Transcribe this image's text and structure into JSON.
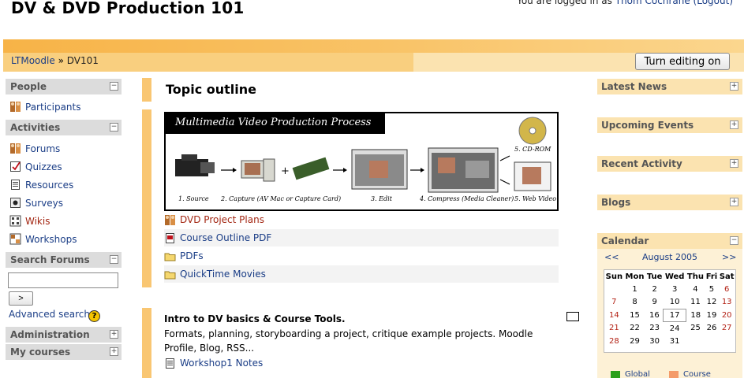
{
  "header": {
    "site_title": "DV & DVD Production 101",
    "login_prefix": "You are logged in as",
    "user_name": "Thom Cochrane",
    "logout_label": "(Logout)"
  },
  "nav": {
    "breadcrumb_home": "LTMoodle",
    "separator": "»",
    "breadcrumb_current": "DV101",
    "turn_editing": "Turn editing on"
  },
  "left": {
    "people": {
      "title": "People",
      "items": [
        {
          "label": "Participants",
          "icon": "participants-icon"
        }
      ]
    },
    "activities": {
      "title": "Activities",
      "items": [
        {
          "label": "Forums",
          "icon": "forum-icon"
        },
        {
          "label": "Quizzes",
          "icon": "quiz-icon"
        },
        {
          "label": "Resources",
          "icon": "resource-icon"
        },
        {
          "label": "Surveys",
          "icon": "survey-icon"
        },
        {
          "label": "Wikis",
          "icon": "wiki-icon"
        },
        {
          "label": "Workshops",
          "icon": "workshop-icon"
        }
      ]
    },
    "search": {
      "title": "Search Forums",
      "value": "",
      "go": ">",
      "advanced": "Advanced search",
      "help": "?"
    },
    "administration": {
      "title": "Administration"
    },
    "my_courses": {
      "title": "My courses"
    },
    "toggle_minus": "−",
    "toggle_plus": "+"
  },
  "center": {
    "topic_outline": "Topic outline",
    "diagram": {
      "banner": "Multimedia Video Production Process",
      "steps": [
        "1. Source",
        "2. Capture (AV Mac or Capture Card)",
        "3. Edit",
        "4. Compress (Media Cleaner)",
        "5. Web Video",
        "5. CD-ROM"
      ],
      "plus": "+"
    },
    "resources": [
      {
        "label": "DVD Project Plans",
        "icon": "workshop-icon",
        "color": "#a32612"
      },
      {
        "label": "Course Outline PDF",
        "icon": "pdf-icon",
        "color": "#1a3d86"
      },
      {
        "label": "PDFs",
        "icon": "folder-icon",
        "color": "#1a3d86"
      },
      {
        "label": "QuickTime Movies",
        "icon": "folder-icon",
        "color": "#1a3d86"
      }
    ],
    "section2": {
      "title": "Intro to DV basics & Course Tools.",
      "text": "Formats, planning, storyboarding a project, critique example projects. Moodle Profile, Blog, RSS...",
      "resource": "Workshop1 Notes"
    }
  },
  "right": {
    "blocks": [
      "Latest News",
      "Upcoming Events",
      "Recent Activity",
      "Blogs"
    ],
    "calendar": {
      "title": "Calendar",
      "prev": "<<",
      "next": ">>",
      "month": "August 2005",
      "days": [
        "Sun",
        "Mon",
        "Tue",
        "Wed",
        "Thu",
        "Fri",
        "Sat"
      ],
      "weeks": [
        [
          "",
          "1",
          "2",
          "3",
          "4",
          "5",
          "6"
        ],
        [
          "7",
          "8",
          "9",
          "10",
          "11",
          "12",
          "13"
        ],
        [
          "14",
          "15",
          "16",
          "17",
          "18",
          "19",
          "20"
        ],
        [
          "21",
          "22",
          "23",
          "24",
          "25",
          "26",
          "27"
        ],
        [
          "28",
          "29",
          "30",
          "31",
          "",
          "",
          ""
        ]
      ],
      "today": "17",
      "legend": [
        {
          "label": "Global",
          "color": "#2ca01c"
        },
        {
          "label": "Course",
          "color": "#f49b6a"
        }
      ]
    }
  },
  "colors": {
    "accent_orange": "#f9c672",
    "link": "#1a3d86",
    "link_red": "#a32612",
    "weekend": "#b21f12"
  }
}
